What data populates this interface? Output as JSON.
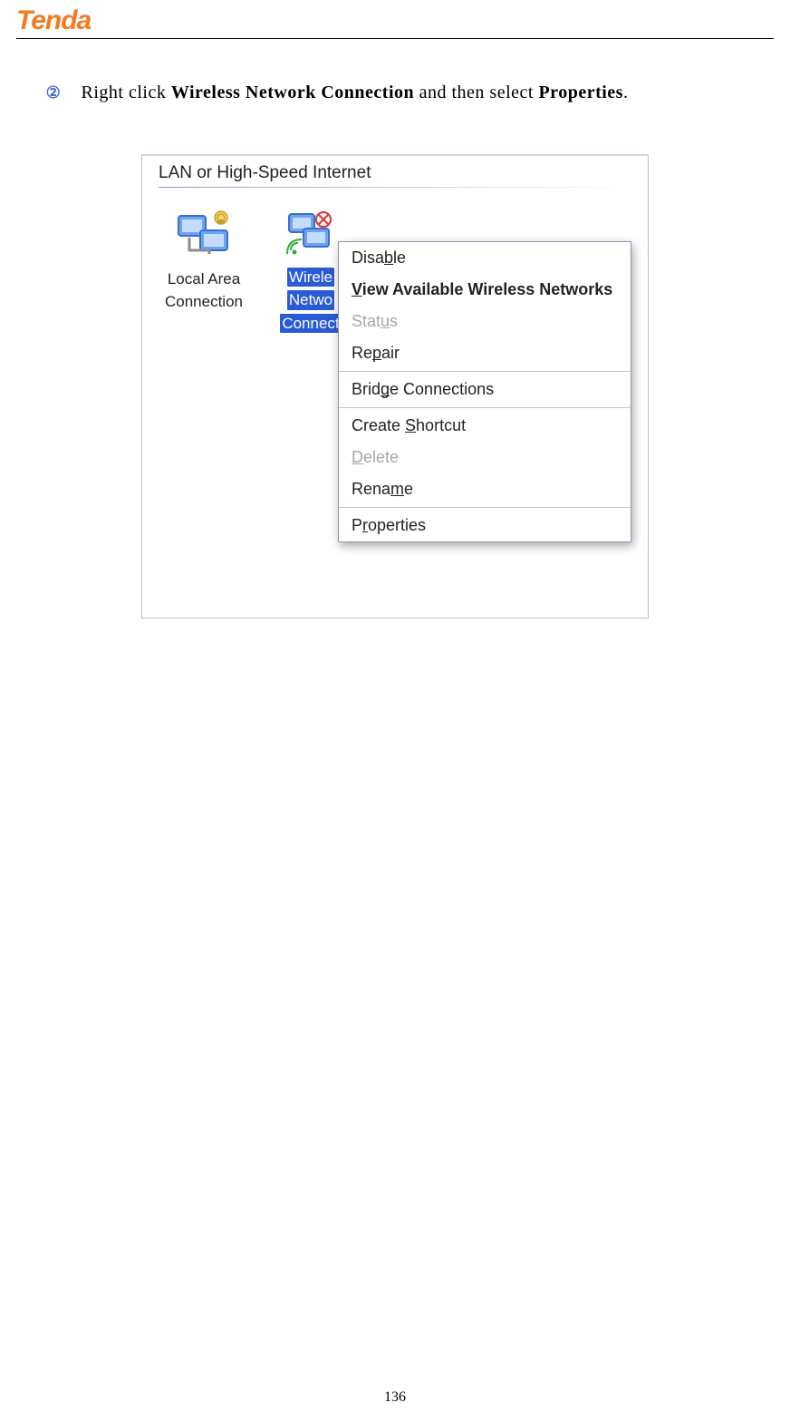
{
  "brand": "Tenda",
  "page_number": "136",
  "step": {
    "number": "②",
    "text_before": "Right click ",
    "bold1": "Wireless Network Connection",
    "text_mid": " and then select ",
    "bold2": "Properties",
    "text_after": "."
  },
  "window": {
    "group_title": "LAN or High-Speed Internet",
    "icons": {
      "lac_line1": "Local Area",
      "lac_line2": "Connection",
      "wnc_line1": "Wirele",
      "wnc_line2": "Netwo",
      "wnc_line3": "Connect"
    }
  },
  "menu": {
    "disable_pre": "Disa",
    "disable_u": "b",
    "disable_post": "le",
    "view_u": "V",
    "view_post": "iew Available Wireless Networks",
    "status_pre": "Stat",
    "status_u": "u",
    "status_post": "s",
    "repair_pre": "Re",
    "repair_u": "p",
    "repair_post": "air",
    "bridge_pre": "Brid",
    "bridge_u": "g",
    "bridge_post": "e Connections",
    "create_pre": "Create ",
    "create_u": "S",
    "create_post": "hortcut",
    "delete_u": "D",
    "delete_post": "elete",
    "rename_pre": "Rena",
    "rename_u": "m",
    "rename_post": "e",
    "properties_pre": "P",
    "properties_u": "r",
    "properties_post": "operties"
  }
}
